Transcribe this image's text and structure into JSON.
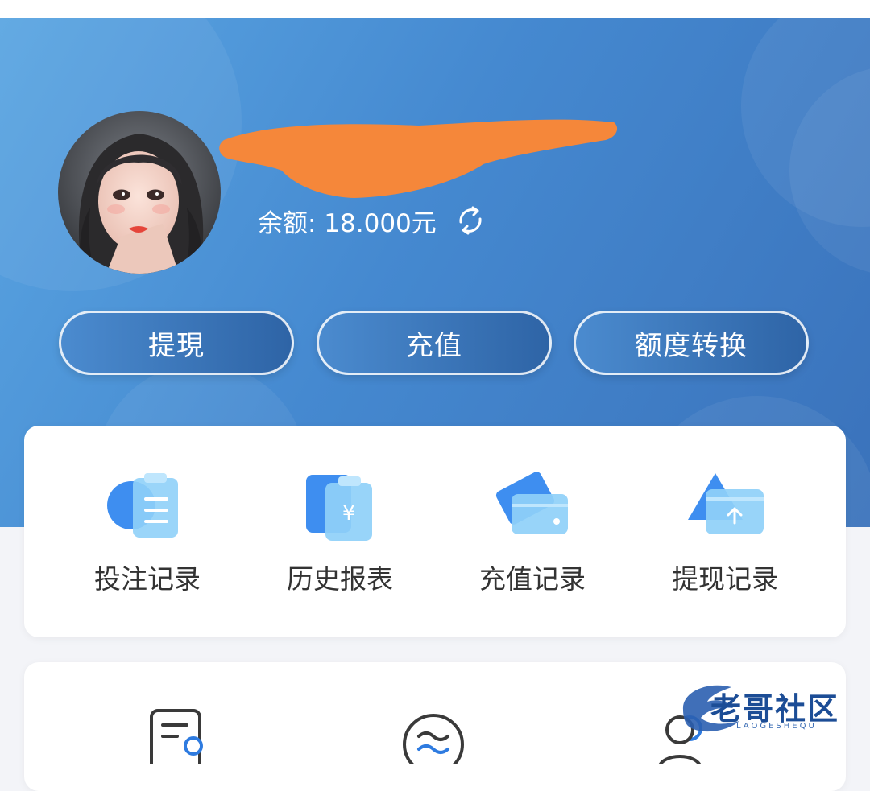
{
  "profile": {
    "balance_text": "余额: 18.000元"
  },
  "actions": {
    "withdraw": "提現",
    "recharge": "充值",
    "transfer": "额度转换"
  },
  "quick_links": [
    {
      "label": "投注记录",
      "icon": "clipboard-list-icon"
    },
    {
      "label": "历史报表",
      "icon": "yuan-document-icon"
    },
    {
      "label": "充值记录",
      "icon": "wallet-icon"
    },
    {
      "label": "提现记录",
      "icon": "upload-box-icon"
    }
  ],
  "watermark": {
    "text": "老哥社区",
    "sub": "LAOGESHEQU"
  },
  "colors": {
    "header_gradient_start": "#5aa5e2",
    "header_gradient_end": "#3a72bb",
    "button_bg": "#2e64a6",
    "icon_blue": "#3e8ef0",
    "redaction_orange": "#f5873a"
  }
}
